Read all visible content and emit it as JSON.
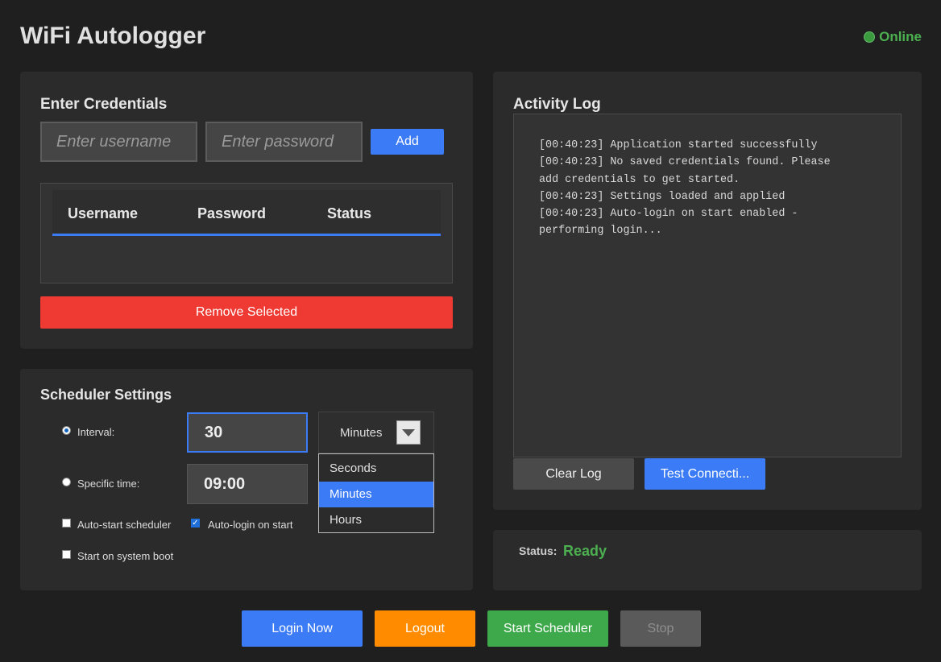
{
  "app": {
    "title": "WiFi Autologger",
    "connection_status": "Online"
  },
  "credentials": {
    "title": "Enter Credentials",
    "username_placeholder": "Enter username",
    "password_placeholder": "Enter password",
    "add_label": "Add",
    "columns": [
      "Username",
      "Password",
      "Status"
    ],
    "rows": [],
    "remove_label": "Remove Selected"
  },
  "scheduler": {
    "title": "Scheduler Settings",
    "interval_label": "Interval:",
    "interval_value": "30",
    "unit_selected": "Minutes",
    "unit_options": [
      "Seconds",
      "Minutes",
      "Hours"
    ],
    "specific_time_label": "Specific time:",
    "specific_time_value": "09:00",
    "auto_start_label": "Auto-start scheduler",
    "auto_login_label": "Auto-login on start",
    "boot_label": "Start on system boot",
    "mode": "interval",
    "auto_start": false,
    "auto_login": true,
    "start_on_boot": false
  },
  "log": {
    "title": "Activity Log",
    "lines": [
      "[00:40:23] Application started successfully",
      "[00:40:23] No saved credentials found. Please\nadd credentials to get started.",
      "[00:40:23] Settings loaded and applied",
      "[00:40:23] Auto-login on start enabled -\nperforming login..."
    ],
    "clear_label": "Clear Log",
    "test_label": "Test Connecti..."
  },
  "status": {
    "label": "Status:",
    "value": "Ready"
  },
  "actions": {
    "login_label": "Login Now",
    "logout_label": "Logout",
    "start_label": "Start Scheduler",
    "stop_label": "Stop"
  },
  "colors": {
    "accent": "#3b7bf5",
    "danger": "#ee3a33",
    "warning": "#ff8c00",
    "success": "#3ea94a",
    "online": "#4caf50"
  }
}
